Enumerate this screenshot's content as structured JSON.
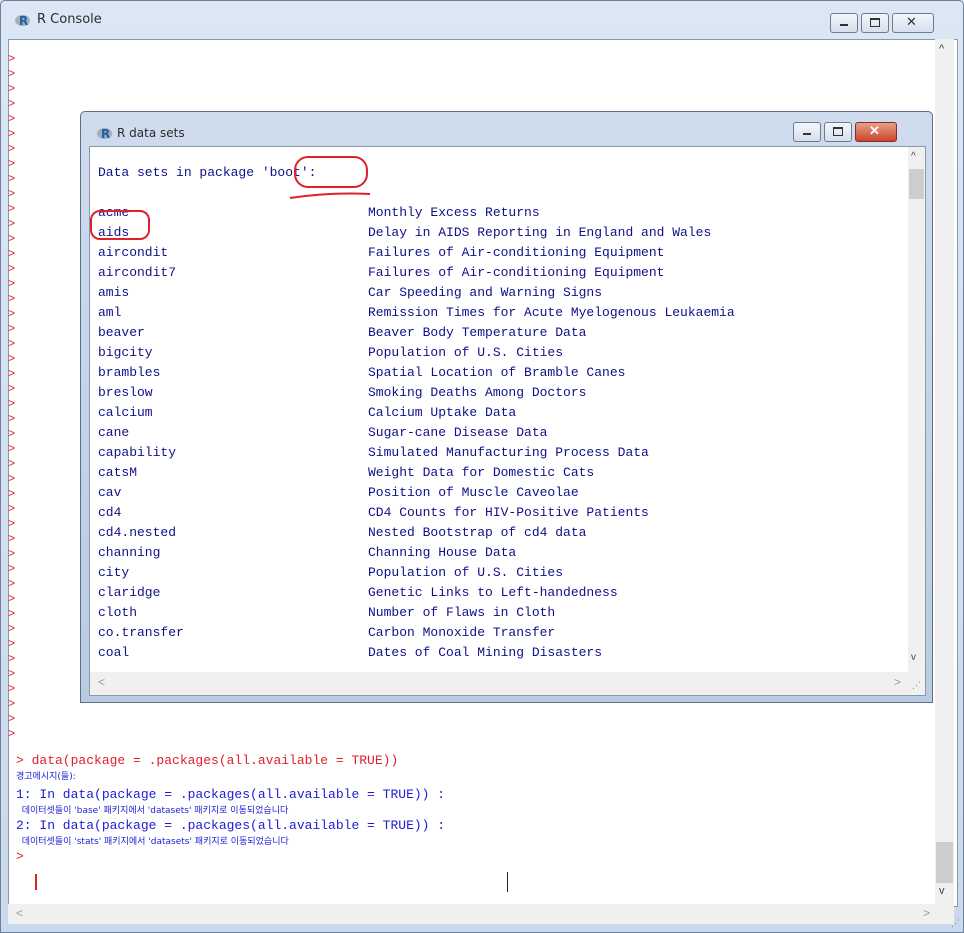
{
  "main_window": {
    "title": "R Console",
    "prompt_symbol": ">",
    "empty_prompt_count": 46,
    "bottom_lines": [
      {
        "kind": "command",
        "text": "> data(package = .packages(all.available = TRUE))"
      },
      {
        "kind": "warning_header",
        "text": "경고메시지(들):"
      },
      {
        "kind": "warning",
        "text": "1: In data(package = .packages(all.available = TRUE)) :"
      },
      {
        "kind": "warning_detail",
        "text": "  데이터셋들이 'base' 패키지에서 'datasets' 패키지로 이동되었습니다"
      },
      {
        "kind": "warning",
        "text": "2: In data(package = .packages(all.available = TRUE)) :"
      },
      {
        "kind": "warning_detail",
        "text": "  데이터셋들이 'stats' 패키지에서 'datasets' 패키지로 이동되었습니다"
      },
      {
        "kind": "prompt",
        "text": "> "
      }
    ]
  },
  "datasets_window": {
    "title": "R data sets",
    "header": "Data sets in package 'boot':",
    "rows": [
      {
        "name": "acme",
        "desc": "Monthly Excess Returns"
      },
      {
        "name": "aids",
        "desc": "Delay in AIDS Reporting in England and Wales"
      },
      {
        "name": "aircondit",
        "desc": "Failures of Air-conditioning Equipment"
      },
      {
        "name": "aircondit7",
        "desc": "Failures of Air-conditioning Equipment"
      },
      {
        "name": "amis",
        "desc": "Car Speeding and Warning Signs"
      },
      {
        "name": "aml",
        "desc": "Remission Times for Acute Myelogenous Leukaemia"
      },
      {
        "name": "beaver",
        "desc": "Beaver Body Temperature Data"
      },
      {
        "name": "bigcity",
        "desc": "Population of U.S. Cities"
      },
      {
        "name": "brambles",
        "desc": "Spatial Location of Bramble Canes"
      },
      {
        "name": "breslow",
        "desc": "Smoking Deaths Among Doctors"
      },
      {
        "name": "calcium",
        "desc": "Calcium Uptake Data"
      },
      {
        "name": "cane",
        "desc": "Sugar-cane Disease Data"
      },
      {
        "name": "capability",
        "desc": "Simulated Manufacturing Process Data"
      },
      {
        "name": "catsM",
        "desc": "Weight Data for Domestic Cats"
      },
      {
        "name": "cav",
        "desc": "Position of Muscle Caveolae"
      },
      {
        "name": "cd4",
        "desc": "CD4 Counts for HIV-Positive Patients"
      },
      {
        "name": "cd4.nested",
        "desc": "Nested Bootstrap of cd4 data"
      },
      {
        "name": "channing",
        "desc": "Channing House Data"
      },
      {
        "name": "city",
        "desc": "Population of U.S. Cities"
      },
      {
        "name": "claridge",
        "desc": "Genetic Links to Left-handedness"
      },
      {
        "name": "cloth",
        "desc": "Number of Flaws in Cloth"
      },
      {
        "name": "co.transfer",
        "desc": "Carbon Monoxide Transfer"
      },
      {
        "name": "coal",
        "desc": "Dates of Coal Mining Disasters"
      }
    ]
  },
  "colors": {
    "prompt": "#e0202a",
    "output": "#1c1cd6",
    "dataset_text": "#10108a",
    "annotation": "#e0202a"
  }
}
